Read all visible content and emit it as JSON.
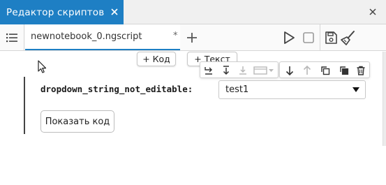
{
  "titlebar": {
    "title": "Редактор скриптов",
    "tab_close_icon": "close-icon",
    "window_close_icon": "close-icon"
  },
  "toolbar": {
    "menu_icon": "list-menu-icon",
    "document_tab": {
      "label": "newnotebook_0.ngscript",
      "modified_marker": "*"
    },
    "add_tab_icon": "plus-icon",
    "run_icon": "play-icon",
    "stop_icon": "stop-icon",
    "save_icon": "save-icon",
    "clean_icon": "broom-icon"
  },
  "editor": {
    "add_code_label": "+ Код",
    "add_text_label": "+ Текст",
    "cell_toolbar": {
      "icons": [
        "run-cell-icon",
        "run-below-icon",
        "download-icon",
        "cell-type-select-icon",
        "move-down-icon",
        "move-up-icon",
        "copy-icon",
        "copy-filled-icon",
        "delete-icon"
      ]
    },
    "widget": {
      "label": "dropdown_string_not_editable:",
      "selected_value": "test1"
    },
    "show_code_label": "Показать код"
  },
  "colors": {
    "accent": "#1e7fc4",
    "titlebar_bg": "#f0f0f0"
  }
}
